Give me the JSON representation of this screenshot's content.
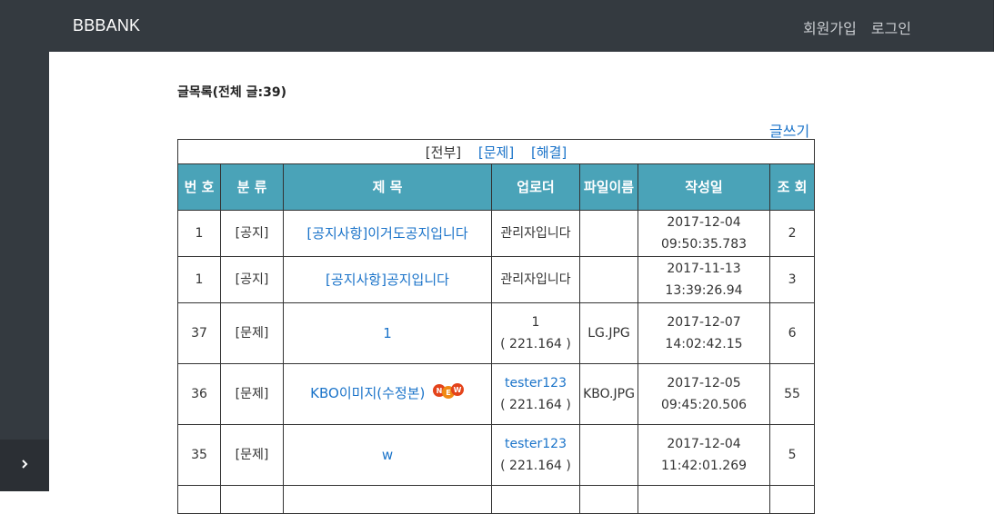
{
  "header": {
    "brand": "BBBANK",
    "nav": {
      "signup": "회원가입",
      "login": "로그인"
    }
  },
  "board": {
    "title": "글목록(전체 글:39)",
    "write_label": "글쓰기",
    "filters": {
      "all": "[전부]",
      "problem": "[문제]",
      "solved": "[해결]"
    },
    "columns": {
      "number": "번 호",
      "category": "분 류",
      "title": "제 목",
      "uploader": "업로더",
      "filename": "파일이름",
      "created": "작성일",
      "views": "조 회"
    },
    "rows": [
      {
        "number": "1",
        "category": "[공지]",
        "title": "[공지사항]이거도공지입니다",
        "uploader": "관리자입니다",
        "uploader_ip": "",
        "filename": "",
        "date": "2017-12-04",
        "time": "09:50:35.783",
        "views": "2"
      },
      {
        "number": "1",
        "category": "[공지]",
        "title": "[공지사항]공지입니다",
        "uploader": "관리자입니다",
        "uploader_ip": "",
        "filename": "",
        "date": "2017-11-13",
        "time": "13:39:26.94",
        "views": "3"
      },
      {
        "number": "37",
        "category": "[문제]",
        "title": "1",
        "uploader": "1",
        "uploader_ip": "( 221.164 )",
        "filename": "LG.JPG",
        "date": "2017-12-07",
        "time": "14:02:42.15",
        "views": "6"
      },
      {
        "number": "36",
        "category": "[문제]",
        "title": "KBO이미지(수정본)",
        "uploader": "tester123",
        "uploader_ip": "( 221.164 )",
        "filename": "KBO.JPG",
        "date": "2017-12-05",
        "time": "09:45:20.506",
        "views": "55",
        "new_badge": "NEW"
      },
      {
        "number": "35",
        "category": "[문제]",
        "title": "w",
        "uploader": "tester123",
        "uploader_ip": "( 221.164 )",
        "filename": "",
        "date": "2017-12-04",
        "time": "11:42:01.269",
        "views": "5"
      }
    ]
  },
  "colors": {
    "topbar": "#343a40",
    "header_cell": "#4aa3b8",
    "link": "#1a73c9"
  }
}
